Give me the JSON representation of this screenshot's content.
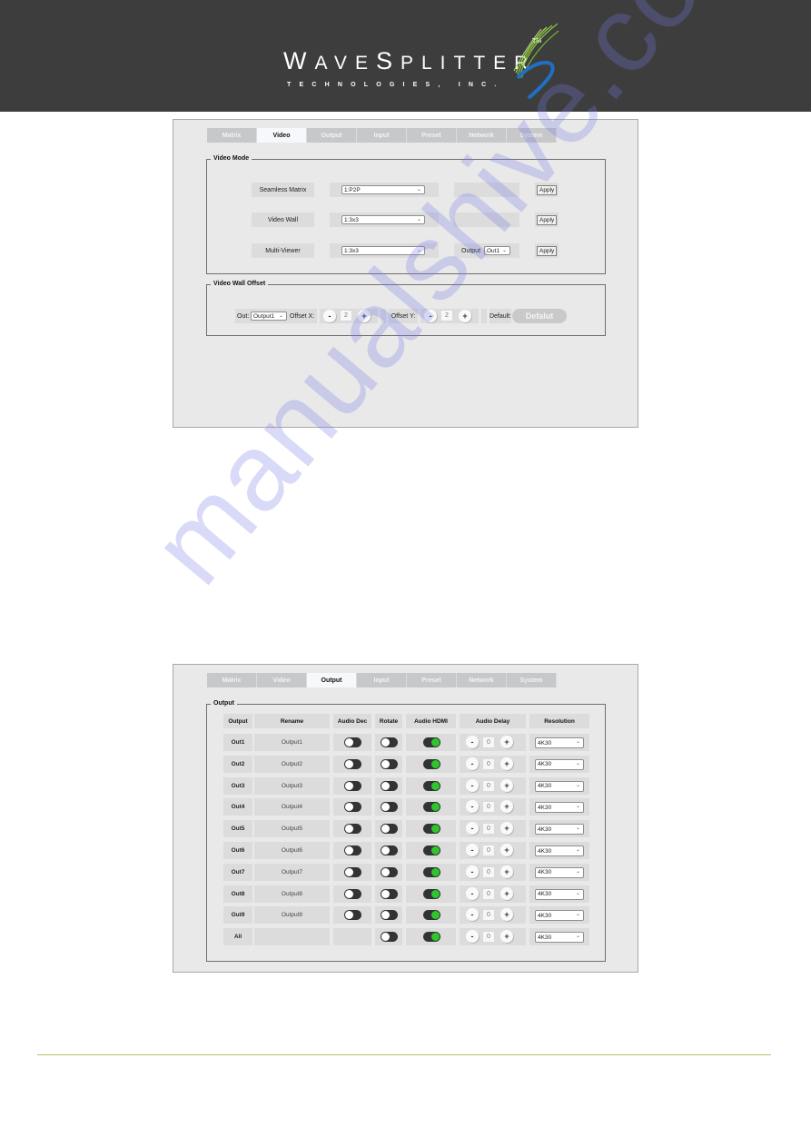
{
  "header": {
    "logo_main_first": "W",
    "logo_main_rest1": "AVE",
    "logo_main_s": "S",
    "logo_main_rest2": "PLITTER",
    "logo_tm": "TM",
    "logo_sub": "TECHNOLOGIES, INC."
  },
  "tabs": [
    "Matrix",
    "Video",
    "Output",
    "Input",
    "Preset",
    "Network",
    "System"
  ],
  "screenshot_video": {
    "active_tab": "Video",
    "video_mode": {
      "legend": "Video Mode",
      "rows": [
        {
          "label": "Seamless Matrix",
          "select_value": "1:P2P",
          "extra": "",
          "apply_label": "Apply"
        },
        {
          "label": "Video Wall",
          "select_value": "1:3x3",
          "extra": "",
          "apply_label": "Apply"
        },
        {
          "label": "Multi-Viewer",
          "select_value": "1:3x3",
          "extra_label": "Output",
          "extra_select": "Out1",
          "apply_label": "Apply"
        }
      ]
    },
    "video_wall_offset": {
      "legend": "Video Wall Offset",
      "out_label": "Out:",
      "out_select": "Output1",
      "offset_x_label": "Offset X:",
      "offset_x_value": "2",
      "offset_y_label": "Offset Y:",
      "offset_y_value": "2",
      "minus": "-",
      "plus": "+",
      "default_label": "Default:",
      "default_button": "Defalut"
    }
  },
  "screenshot_output": {
    "active_tab": "Output",
    "legend": "Output",
    "columns": [
      "Output",
      "Rename",
      "Audio Dec",
      "Rotate",
      "Audio HDMI",
      "Audio Delay",
      "Resolution"
    ],
    "rows": [
      {
        "output": "Out1",
        "rename": "Output1",
        "audio_dec": false,
        "rotate": false,
        "audio_hdmi": true,
        "delay": "0",
        "resolution": "4K30"
      },
      {
        "output": "Out2",
        "rename": "Output2",
        "audio_dec": false,
        "rotate": false,
        "audio_hdmi": true,
        "delay": "0",
        "resolution": "4K30"
      },
      {
        "output": "Out3",
        "rename": "Output3",
        "audio_dec": false,
        "rotate": false,
        "audio_hdmi": true,
        "delay": "0",
        "resolution": "4K30"
      },
      {
        "output": "Out4",
        "rename": "Output4",
        "audio_dec": false,
        "rotate": false,
        "audio_hdmi": true,
        "delay": "0",
        "resolution": "4K30"
      },
      {
        "output": "Out5",
        "rename": "Output5",
        "audio_dec": false,
        "rotate": false,
        "audio_hdmi": true,
        "delay": "0",
        "resolution": "4K30"
      },
      {
        "output": "Out6",
        "rename": "Output6",
        "audio_dec": false,
        "rotate": false,
        "audio_hdmi": true,
        "delay": "0",
        "resolution": "4K30"
      },
      {
        "output": "Out7",
        "rename": "Output7",
        "audio_dec": false,
        "rotate": false,
        "audio_hdmi": true,
        "delay": "0",
        "resolution": "4K30"
      },
      {
        "output": "Out8",
        "rename": "Output8",
        "audio_dec": false,
        "rotate": false,
        "audio_hdmi": true,
        "delay": "0",
        "resolution": "4K30"
      },
      {
        "output": "Out9",
        "rename": "Output9",
        "audio_dec": false,
        "rotate": false,
        "audio_hdmi": true,
        "delay": "0",
        "resolution": "4K30"
      },
      {
        "output": "All",
        "rename": "",
        "audio_dec": null,
        "rotate": false,
        "audio_hdmi": true,
        "delay": "0",
        "resolution": "4K30"
      }
    ],
    "minus": "-",
    "plus": "+"
  },
  "watermark": "manualshive.com",
  "colors": {
    "header_bg": "#3d3d3d",
    "toggle_on": "#2dc72d",
    "footer_line": "#b5c36b"
  }
}
